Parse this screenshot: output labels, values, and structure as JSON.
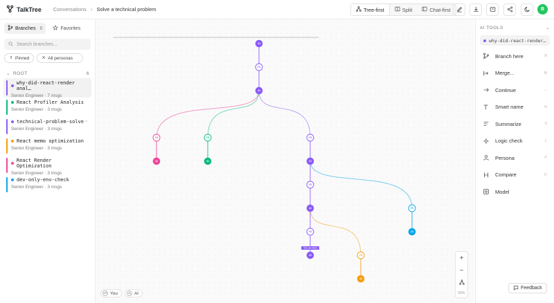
{
  "app": {
    "name": "TalkTree",
    "user_initial": "B"
  },
  "breadcrumb": {
    "root": "Conversations",
    "current": "Solve a technical problem"
  },
  "view_modes": [
    {
      "label": "Tree-first",
      "active": true
    },
    {
      "label": "Split",
      "active": false
    },
    {
      "label": "Chat-first",
      "active": false
    }
  ],
  "sidebar": {
    "tabs": [
      {
        "label": "Branches",
        "count": "6",
        "active": true
      },
      {
        "label": "Favorites",
        "count": "",
        "active": false
      }
    ],
    "search_placeholder": "Search branches...",
    "filters": [
      "Pinned",
      "All personas"
    ],
    "root_label": "ROOT",
    "root_count": "6",
    "branches": [
      {
        "title": "why-did-react-render anal…",
        "persona": "Senior Engineer",
        "msgs": "7 msgs",
        "color": "#8b5cf6",
        "active": true,
        "has_chevron": false
      },
      {
        "title": "React Profiler Analysis",
        "persona": "Senior Engineer",
        "msgs": "3 msgs",
        "color": "#10b981",
        "active": false,
        "has_chevron": false
      },
      {
        "title": "technical-problem-solve",
        "persona": "Senior Engineer",
        "msgs": "3 msgs",
        "color": "#8b5cf6",
        "active": false,
        "has_chevron": true
      },
      {
        "title": "React memo optimization",
        "persona": "Senior Engineer",
        "msgs": "3 msgs",
        "color": "#f59e0b",
        "active": false,
        "has_chevron": false
      },
      {
        "title": "React Render Optimization",
        "persona": "Senior Engineer",
        "msgs": "3 msgs",
        "color": "#ec4899",
        "active": false,
        "has_chevron": false
      },
      {
        "title": "dev-only-env-check",
        "persona": "Senior Engineer",
        "msgs": "3 msgs",
        "color": "#0ea5e9",
        "active": false,
        "has_chevron": false
      }
    ]
  },
  "canvas": {
    "you_are_here": "You are here",
    "node_ai_label": "AI",
    "node_you_label": "YO",
    "legend": {
      "you": "You",
      "ai": "AI",
      "you_badge": "YO",
      "ai_badge": "AI"
    },
    "zoom_percent": "55%"
  },
  "tools": {
    "header": "AI TOOLS",
    "selected_branch": "why-did-react-render…",
    "items": [
      {
        "label": "Branch here",
        "key": "B",
        "icon": "branch-icon"
      },
      {
        "label": "Merge...",
        "key": "M",
        "icon": "merge-icon"
      },
      {
        "label": "Continue",
        "key": "→",
        "icon": "continue-icon"
      },
      {
        "label": "Smart name",
        "key": "N",
        "icon": "text-icon"
      },
      {
        "label": "Summarize",
        "key": "S",
        "icon": "summarize-icon"
      },
      {
        "label": "Logic check",
        "key": "L",
        "icon": "logic-icon"
      },
      {
        "label": "Persona",
        "key": "P",
        "icon": "persona-icon"
      },
      {
        "label": "Compare",
        "key": "D",
        "icon": "compare-icon"
      },
      {
        "label": "Model",
        "key": "",
        "icon": "model-icon"
      }
    ]
  },
  "feedback_label": "Feedback",
  "colors": {
    "purple": "#8b5cf6",
    "pink": "#ec4899",
    "green": "#10b981",
    "blue": "#0ea5e9",
    "orange": "#f59e0b",
    "brand": "#22c55e"
  }
}
